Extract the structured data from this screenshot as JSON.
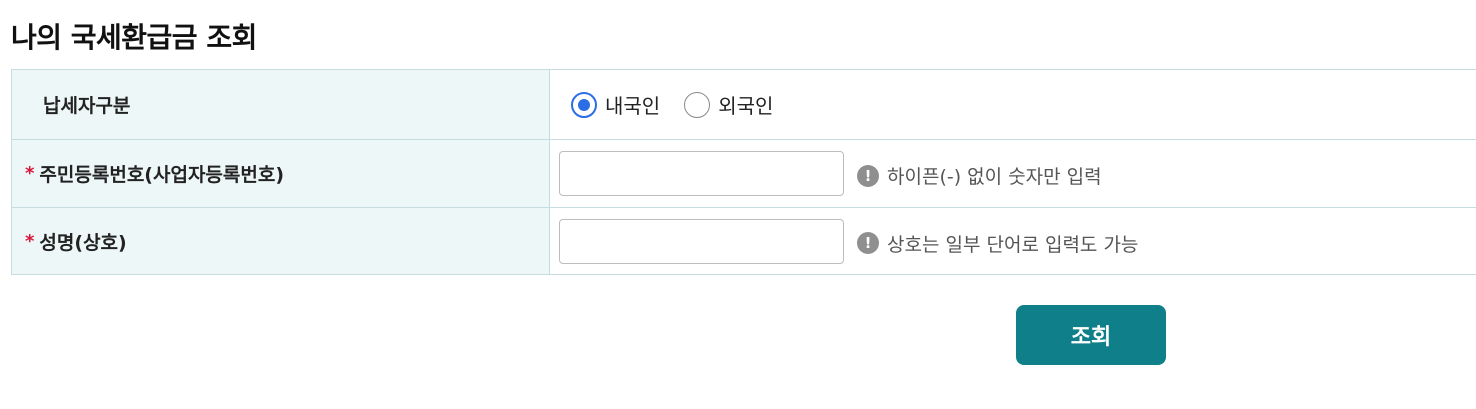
{
  "page": {
    "title": "나의 국세환급금 조회"
  },
  "form": {
    "taxpayer_type": {
      "label": "납세자구분",
      "options": [
        {
          "label": "내국인",
          "selected": true
        },
        {
          "label": "외국인",
          "selected": false
        }
      ]
    },
    "resident_number": {
      "required_mark": "*",
      "label": "주민등록번호(사업자등록번호)",
      "value": "",
      "hint": "하이픈(-) 없이 숫자만 입력"
    },
    "name": {
      "required_mark": "*",
      "label": "성명(상호)",
      "value": "",
      "hint": "상호는 일부 단어로 입력도 가능"
    },
    "hint_icon_symbol": "!",
    "hint_icon": "exclamation-icon"
  },
  "actions": {
    "search_label": "조회"
  },
  "colors": {
    "accent": "#0f7f8a",
    "radio_selected": "#2b6ee3",
    "required": "#d6173a",
    "label_bg": "#eef7f7",
    "border": "#c6dde0"
  }
}
